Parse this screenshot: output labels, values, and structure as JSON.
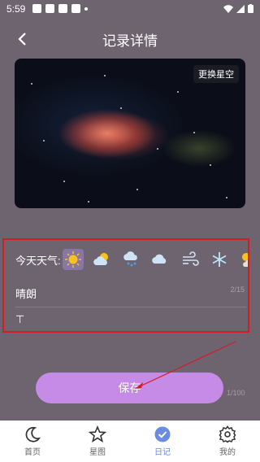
{
  "status_bar": {
    "time": "5:59"
  },
  "header": {
    "title": "记录详情"
  },
  "hero": {
    "change_label": "更换星空"
  },
  "weather": {
    "label": "今天天气:",
    "icons": [
      "sunny-icon",
      "partly-cloudy-icon",
      "rain-icon",
      "cloudy-icon",
      "wind-icon",
      "snow-icon",
      "sun-cloud-icon"
    ],
    "selected_index": 0
  },
  "condition": {
    "value": "晴朗",
    "counter": "2/15"
  },
  "content": {
    "cursor": "⊤",
    "counter": "1/100"
  },
  "save": {
    "label": "保存"
  },
  "tabs": [
    {
      "label": "首页",
      "icon": "moon-icon"
    },
    {
      "label": "星图",
      "icon": "star-icon"
    },
    {
      "label": "日记",
      "icon": "check-badge-icon",
      "active": true
    },
    {
      "label": "我的",
      "icon": "gear-icon"
    }
  ],
  "colors": {
    "accent": "#c58be6",
    "tab_active": "#6a8de0",
    "highlight_border": "#d51c24"
  }
}
